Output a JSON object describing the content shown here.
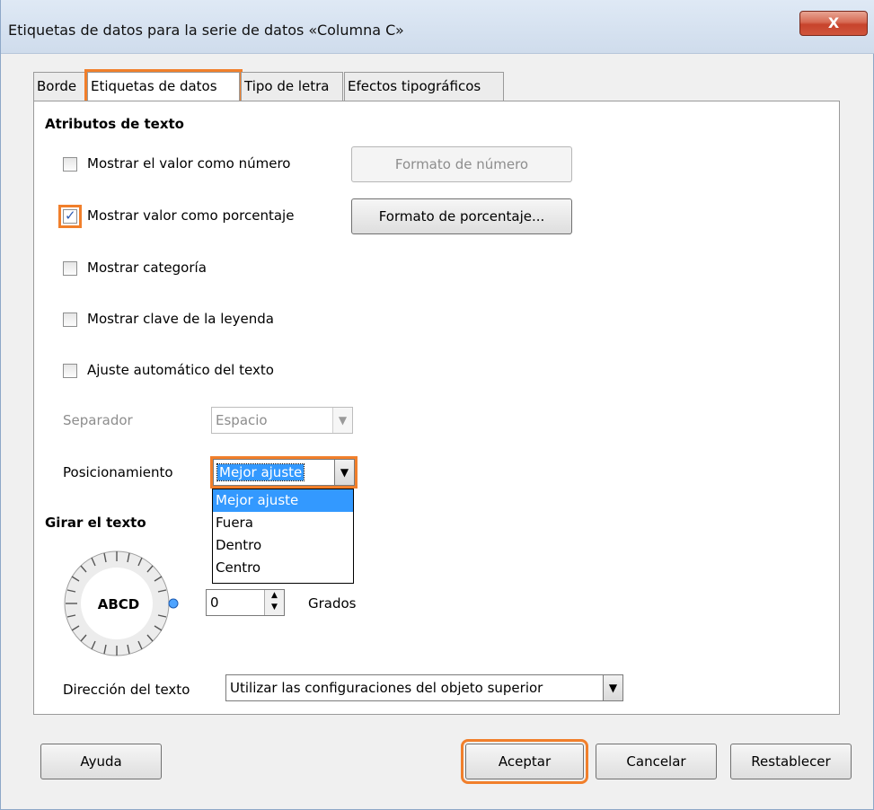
{
  "dialog": {
    "title": "Etiquetas de datos para la serie de datos «Columna C»",
    "close_label": "X"
  },
  "tabs": [
    {
      "label": "Borde"
    },
    {
      "label": "Etiquetas de datos"
    },
    {
      "label": "Tipo de letra"
    },
    {
      "label": "Efectos tipográficos"
    }
  ],
  "text_attributes": {
    "section_title": "Atributos de texto",
    "show_value_number": {
      "label": "Mostrar el valor como número",
      "checked": false
    },
    "number_format_button": "Formato de número",
    "show_value_percent": {
      "label": "Mostrar valor como porcentaje",
      "checked": true
    },
    "percent_format_button": "Formato de porcentaje...",
    "show_category": {
      "label": "Mostrar categoría",
      "checked": false
    },
    "show_legend_key": {
      "label": "Mostrar clave de la leyenda",
      "checked": false
    },
    "auto_wrap": {
      "label": "Ajuste automático del texto",
      "checked": false
    },
    "separator": {
      "label": "Separador",
      "value": "Espacio"
    },
    "placement": {
      "label": "Posicionamiento",
      "value": "Mejor ajuste",
      "options": [
        "Mejor ajuste",
        "Fuera",
        "Dentro",
        "Centro"
      ]
    }
  },
  "rotate": {
    "section_title": "Girar el texto",
    "dial_text": "ABCD",
    "degrees_value": "0",
    "degrees_label": "Grados"
  },
  "text_direction": {
    "label": "Dirección del texto",
    "value": "Utilizar las configuraciones del objeto superior"
  },
  "buttons": {
    "help": "Ayuda",
    "ok": "Aceptar",
    "cancel": "Cancelar",
    "reset": "Restablecer"
  },
  "colors": {
    "highlight": "#f17f2b",
    "selection": "#3399ff"
  }
}
